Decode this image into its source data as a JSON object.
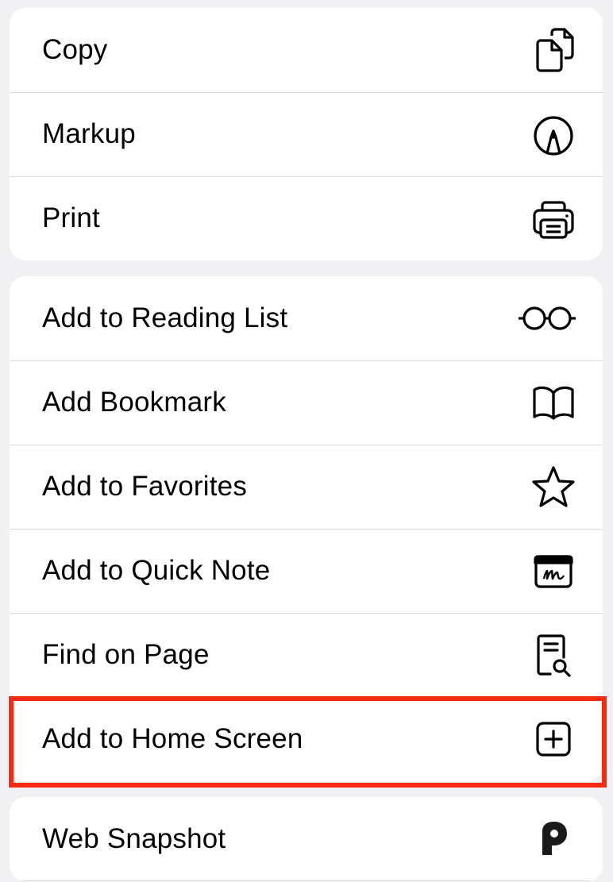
{
  "groups": [
    {
      "items": [
        {
          "label": "Copy",
          "icon": "copy-icon"
        },
        {
          "label": "Markup",
          "icon": "markup-icon"
        },
        {
          "label": "Print",
          "icon": "print-icon"
        }
      ]
    },
    {
      "items": [
        {
          "label": "Add to Reading List",
          "icon": "glasses-icon"
        },
        {
          "label": "Add Bookmark",
          "icon": "book-icon"
        },
        {
          "label": "Add to Favorites",
          "icon": "star-icon"
        },
        {
          "label": "Add to Quick Note",
          "icon": "quick-note-icon"
        },
        {
          "label": "Find on Page",
          "icon": "find-on-page-icon"
        },
        {
          "label": "Add to Home Screen",
          "icon": "plus-square-icon",
          "highlighted": true
        }
      ]
    },
    {
      "items": [
        {
          "label": "Web Snapshot",
          "icon": "web-snapshot-app-icon"
        }
      ]
    }
  ],
  "colors": {
    "highlight": "#f52a12",
    "background": "#f1f0f3",
    "card": "#ffffff"
  }
}
